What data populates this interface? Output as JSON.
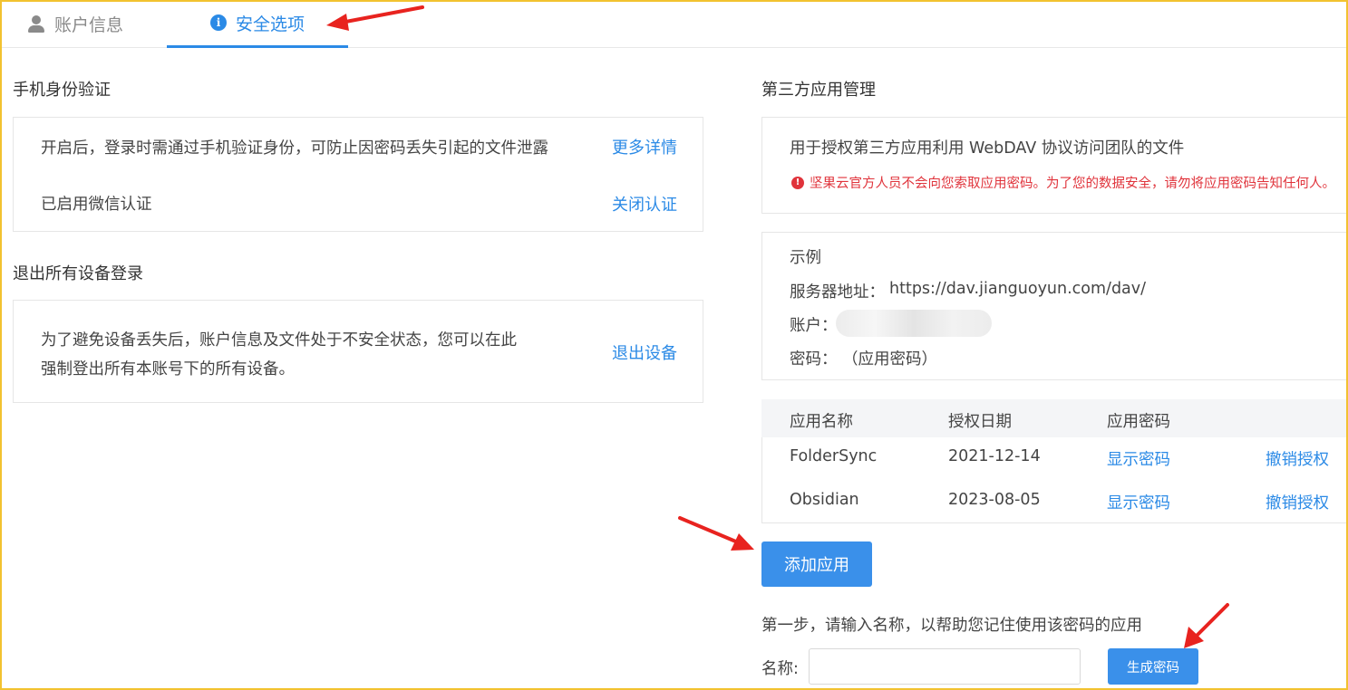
{
  "tabs": {
    "account_label": "账户信息",
    "security_label": "安全选项"
  },
  "phone_verify": {
    "title": "手机身份验证",
    "description": "开启后，登录时需通过手机验证身份，可防止因密码丢失引起的文件泄露",
    "more_link": "更多详情",
    "status": "已启用微信认证",
    "disable_link": "关闭认证"
  },
  "logout_devices": {
    "title": "退出所有设备登录",
    "description_line1": "为了避免设备丢失后，账户信息及文件处于不安全状态，您可以在此",
    "description_line2": "强制登出所有本账号下的所有设备。",
    "logout_link": "退出设备"
  },
  "third_party": {
    "title": "第三方应用管理",
    "description": "用于授权第三方应用利用 WebDAV 协议访问团队的文件",
    "warning": "坚果云官方人员不会向您索取应用密码。为了您的数据安全，请勿将应用密码告知任何人。",
    "example": {
      "heading": "示例",
      "server_label": "服务器地址：",
      "server_value": "https://dav.jianguoyun.com/dav/",
      "account_label": "账户：",
      "password_label": "密码：",
      "password_value": "（应用密码）"
    },
    "table": {
      "headers": [
        "应用名称",
        "授权日期",
        "应用密码"
      ],
      "rows": [
        {
          "name": "FolderSync",
          "date": "2021-12-14",
          "show": "显示密码",
          "revoke": "撤销授权"
        },
        {
          "name": "Obsidian",
          "date": "2023-08-05",
          "show": "显示密码",
          "revoke": "撤销授权"
        }
      ]
    },
    "add_button": "添加应用",
    "step_text": "第一步，请输入名称，以帮助您记住使用该密码的应用",
    "name_label": "名称:",
    "name_value": "",
    "generate_button": "生成密码"
  },
  "colors": {
    "accent": "#2b8ae6",
    "button": "#3a90ea",
    "warning": "#e0333b",
    "annotation_arrow": "#e8231f",
    "frame": "#f2c230"
  }
}
